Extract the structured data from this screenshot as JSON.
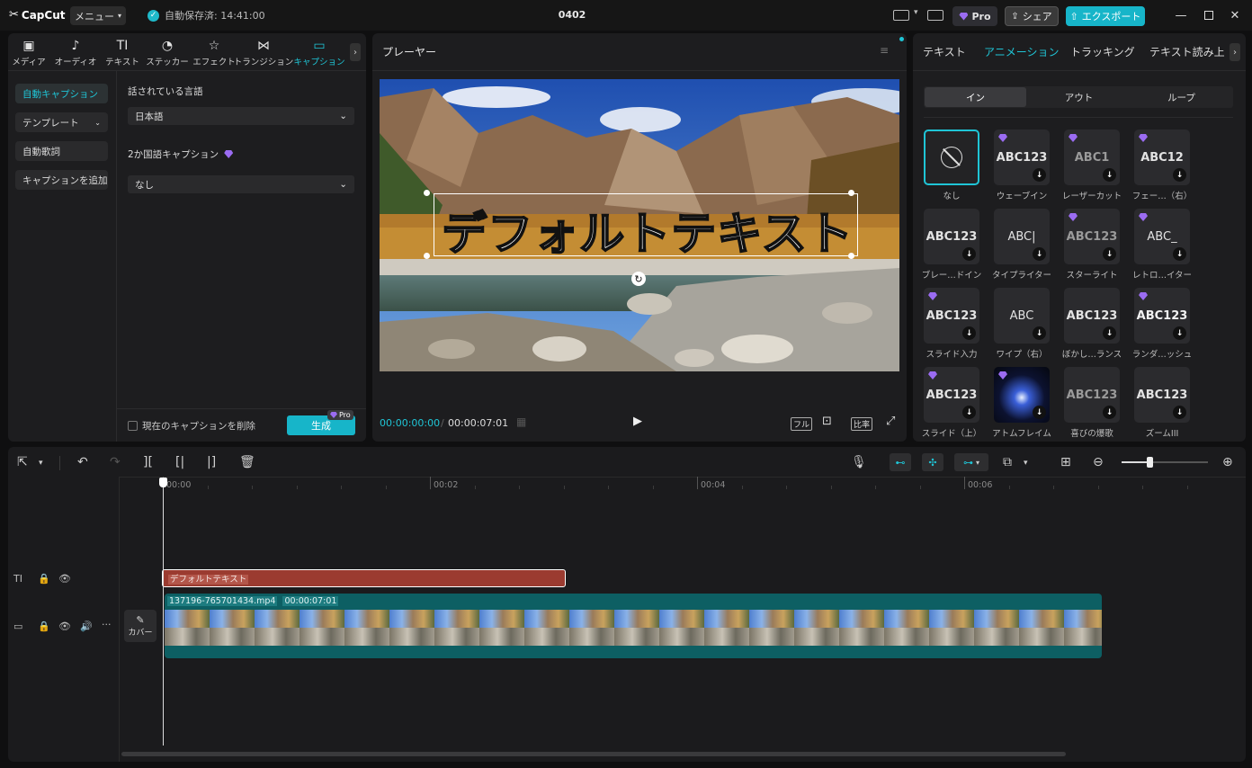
{
  "titlebar": {
    "logo": "CapCut",
    "menu": "メニュー",
    "autosave": "自動保存済: 14:41:00",
    "project": "0402",
    "pro": "Pro",
    "share": "シェア",
    "export": "エクスポート"
  },
  "left": {
    "tabs": [
      {
        "label": "メディア",
        "icon": "media-icon"
      },
      {
        "label": "オーディオ",
        "icon": "audio-icon"
      },
      {
        "label": "テキスト",
        "icon": "text-icon"
      },
      {
        "label": "ステッカー",
        "icon": "sticker-icon"
      },
      {
        "label": "エフェクト",
        "icon": "effect-icon"
      },
      {
        "label": "トランジション",
        "icon": "transition-icon"
      },
      {
        "label": "キャプション",
        "icon": "caption-icon"
      }
    ],
    "side": [
      "自動キャプション",
      "テンプレート",
      "自動歌詞",
      "キャプションを追加"
    ],
    "lang_label": "話されている言語",
    "lang_value": "日本語",
    "bilingual_label": "2か国語キャプション",
    "bilingual_value": "なし",
    "delete_label": "現在のキャプションを削除",
    "generate": "生成",
    "pro_badge": "Pro"
  },
  "player": {
    "title": "プレーヤー",
    "overlay_text": "デフォルトテキスト",
    "time_current": "00:00:00:00",
    "time_total": "00:00:07:01",
    "full": "フル",
    "ratio": "比率"
  },
  "right": {
    "tabs": [
      "テキスト",
      "アニメーション",
      "トラッキング",
      "テキスト読み上"
    ],
    "segments": [
      "イン",
      "アウト",
      "ループ"
    ],
    "effects": [
      {
        "label": "なし",
        "thumb": ""
      },
      {
        "label": "ウェーブイン",
        "thumb": "ABC123"
      },
      {
        "label": "レーザーカット",
        "thumb": "ABC1"
      },
      {
        "label": "フェー…（右）",
        "thumb": "ABC12"
      },
      {
        "label": "ブレー…ドイン",
        "thumb": "ABC123"
      },
      {
        "label": "タイプライター",
        "thumb": "ABC|"
      },
      {
        "label": "スターライト",
        "thumb": "ABC123"
      },
      {
        "label": "レトロ…イター",
        "thumb": "ABC_"
      },
      {
        "label": "スライド入力",
        "thumb": "ABC123"
      },
      {
        "label": "ワイプ（右）",
        "thumb": "ABC"
      },
      {
        "label": "ぼかし…ランス",
        "thumb": "ABC123"
      },
      {
        "label": "ランダ…ッシュ",
        "thumb": "ABC123"
      },
      {
        "label": "スライド（上）",
        "thumb": "ABC123"
      },
      {
        "label": "アトムフレイム",
        "thumb": ""
      },
      {
        "label": "喜びの爆歌",
        "thumb": "ABC123"
      },
      {
        "label": "ズームIII",
        "thumb": "ABC123"
      }
    ]
  },
  "timeline": {
    "ruler": [
      "00:00",
      "00:02",
      "00:04",
      "00:06"
    ],
    "text_clip": "デフォルトテキスト",
    "video_name": "137196-765701434.mp4",
    "video_duration": "00:00:07:01",
    "cover": "カバー"
  },
  "colors": {
    "accent": "#1fc5d6",
    "text_clip": "#9b3b30",
    "video_clip": "#0d5f63"
  }
}
